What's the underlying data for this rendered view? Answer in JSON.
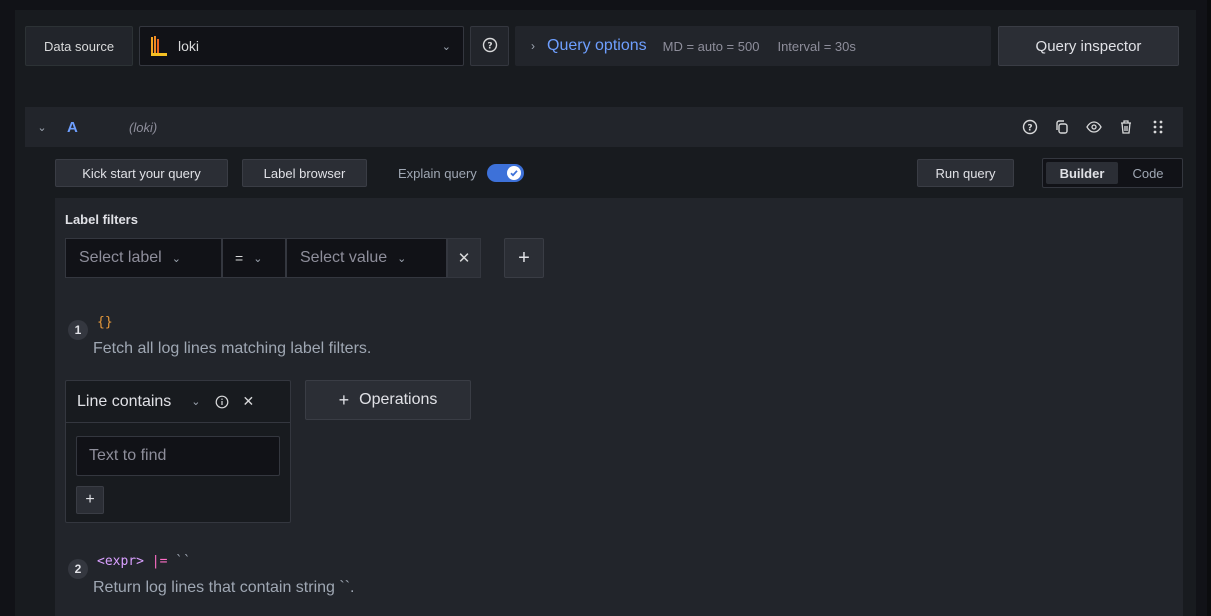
{
  "toolbar": {
    "data_source_label": "Data source",
    "data_source_value": "loki",
    "query_options_label": "Query options",
    "max_data_points": "MD = auto = 500",
    "interval": "Interval = 30s",
    "query_inspector_label": "Query inspector"
  },
  "query": {
    "ref_id": "A",
    "datasource_name": "(loki)",
    "actions": [
      "help-icon",
      "duplicate-icon",
      "eye-icon",
      "trash-icon",
      "drag-handle-icon"
    ],
    "kick_start_label": "Kick start your query",
    "label_browser_label": "Label browser",
    "explain_query_label": "Explain query",
    "explain_query_enabled": true,
    "run_query_label": "Run query",
    "mode_builder": "Builder",
    "mode_code": "Code",
    "active_mode": "Builder"
  },
  "builder": {
    "label_filters_title": "Label filters",
    "label_placeholder": "Select label",
    "operator_value": "=",
    "value_placeholder": "Select value",
    "steps": [
      {
        "number": "1",
        "code": "{}",
        "description": "Fetch all log lines matching label filters."
      },
      {
        "number": "2",
        "code_expr": "<expr>",
        "code_op": "|=",
        "code_str": "``",
        "description": "Return log lines that contain string ``."
      }
    ],
    "operation": {
      "name": "Line contains",
      "text_placeholder": "Text to find"
    },
    "operations_button_label": "Operations"
  },
  "colors": {
    "accent": "#6e9fff",
    "toggle_on": "#3d71d9",
    "background": "#111217",
    "panel": "#181b1f"
  }
}
